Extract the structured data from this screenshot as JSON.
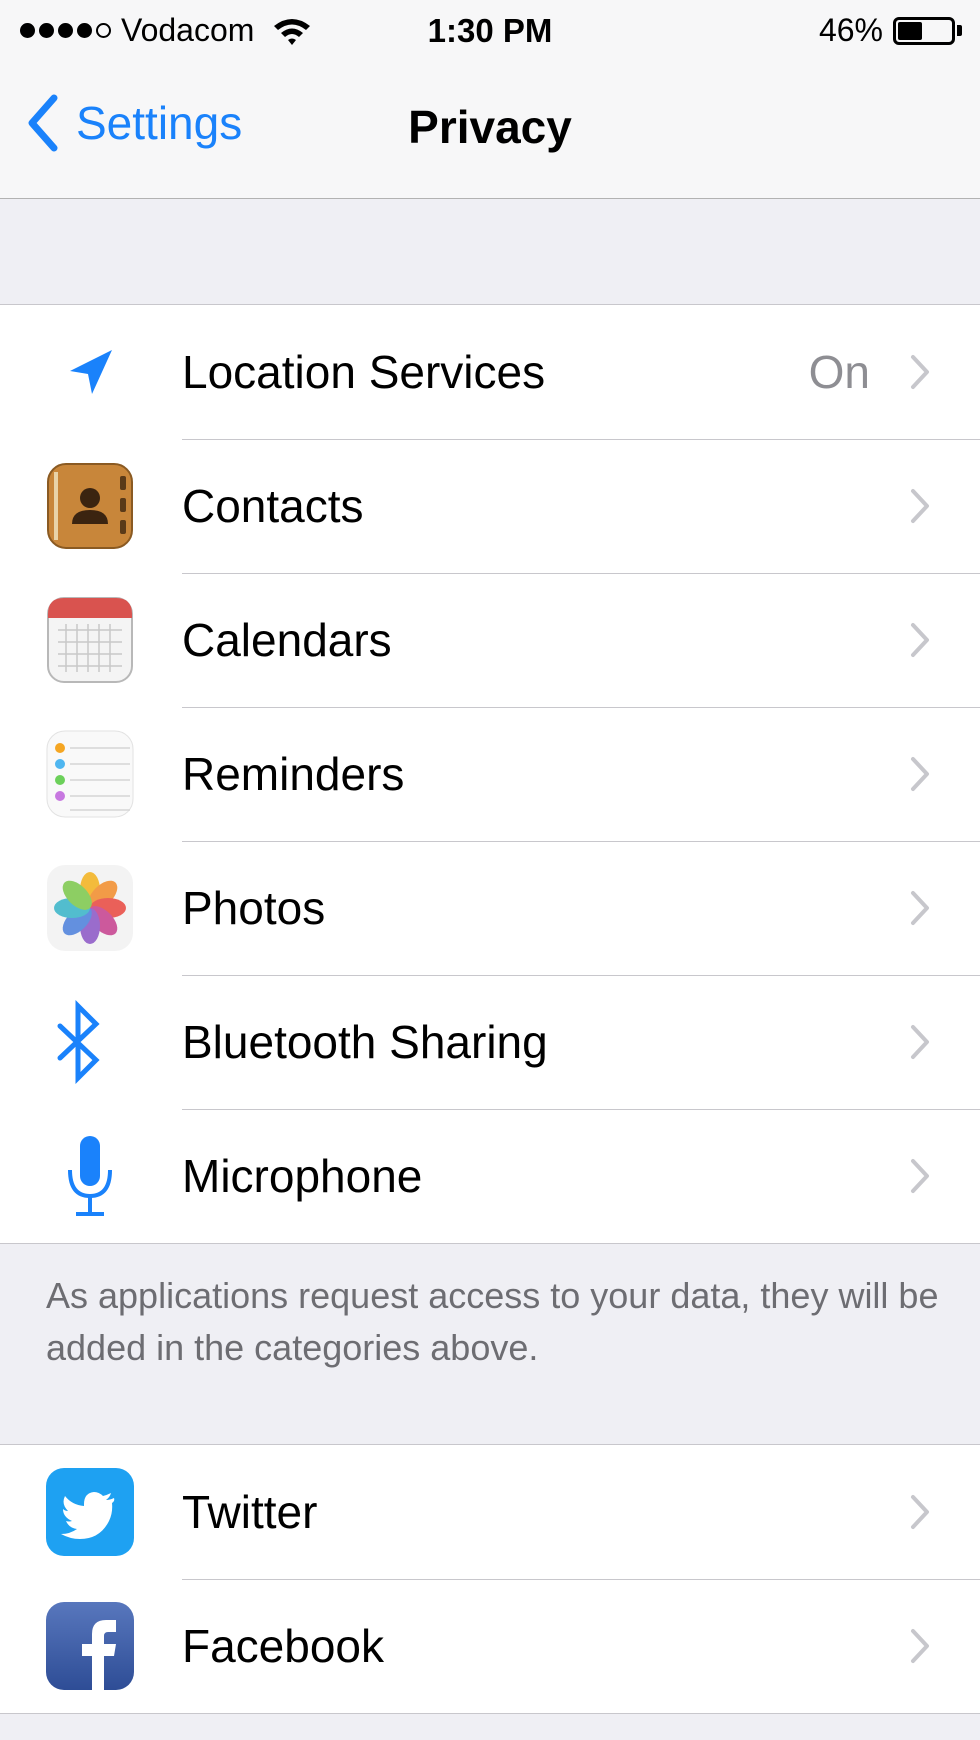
{
  "status_bar": {
    "signal_bars_filled": 4,
    "signal_bars_total": 5,
    "carrier": "Vodacom",
    "time": "1:30 PM",
    "battery_percent_text": "46%",
    "battery_level": 0.46
  },
  "nav": {
    "back_label": "Settings",
    "title": "Privacy"
  },
  "privacy_items": [
    {
      "label": "Location Services",
      "value": "On",
      "icon": "location-arrow-icon"
    },
    {
      "label": "Contacts",
      "icon": "contacts-icon"
    },
    {
      "label": "Calendars",
      "icon": "calendar-icon"
    },
    {
      "label": "Reminders",
      "icon": "reminders-icon"
    },
    {
      "label": "Photos",
      "icon": "photos-icon"
    },
    {
      "label": "Bluetooth Sharing",
      "icon": "bluetooth-icon"
    },
    {
      "label": "Microphone",
      "icon": "microphone-icon"
    }
  ],
  "footer_note": "As applications request access to your data, they will be added in the categories above.",
  "social_items": [
    {
      "label": "Twitter",
      "icon": "twitter-icon"
    },
    {
      "label": "Facebook",
      "icon": "facebook-icon"
    }
  ],
  "colors": {
    "accent": "#1a82fb",
    "background": "#efeff4",
    "secondary_text": "#8e8e93",
    "separator": "#c8c7cc"
  }
}
